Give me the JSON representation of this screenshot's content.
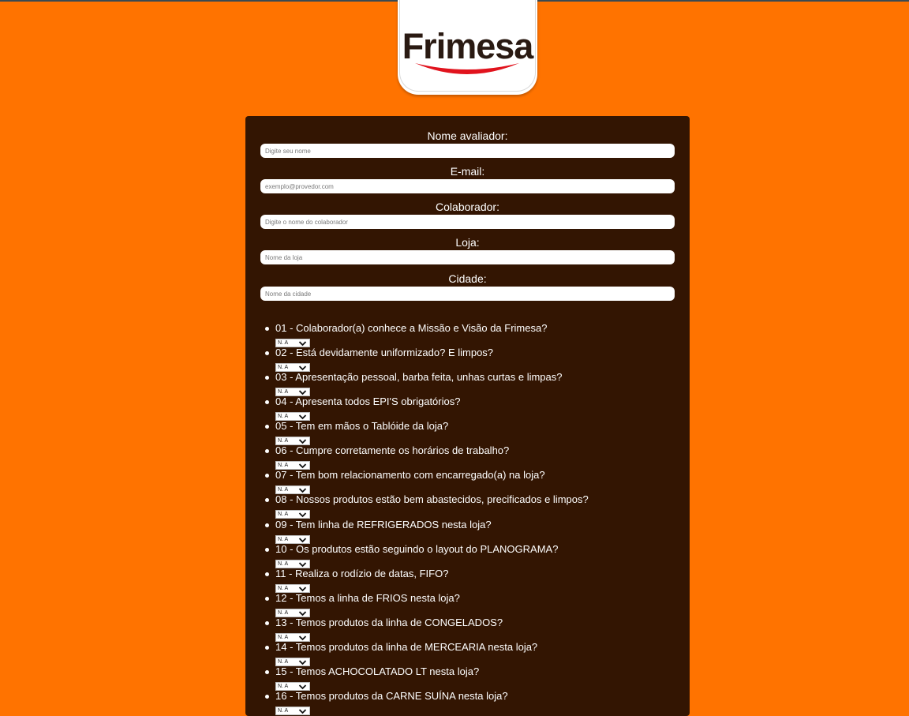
{
  "brand": {
    "logo_text": "Frimesa",
    "accent": "#ff7300",
    "panel": "#331502"
  },
  "form": {
    "fields": [
      {
        "label": "Nome avaliador:",
        "placeholder": "Digite seu nome"
      },
      {
        "label": "E-mail:",
        "placeholder": "exemplo@provedor.com"
      },
      {
        "label": "Colaborador:",
        "placeholder": "Digite o nome do colaborador"
      },
      {
        "label": "Loja:",
        "placeholder": "Nome da loja"
      },
      {
        "label": "Cidade:",
        "placeholder": "Nome da cidade"
      }
    ],
    "questions": [
      {
        "text": "01 - Colaborador(a) conhece a Missão e Visão da Frimesa?",
        "value": "N. A"
      },
      {
        "text": "02 - Está devidamente uniformizado? E limpos?",
        "value": "N. A"
      },
      {
        "text": "03 - Apresentação pessoal, barba feita, unhas curtas e limpas?",
        "value": "N. A"
      },
      {
        "text": "04 - Apresenta todos EPI'S obrigatórios?",
        "value": "N. A"
      },
      {
        "text": "05 - Tem em mãos o Tablóide da loja?",
        "value": "N. A"
      },
      {
        "text": "06 - Cumpre corretamente os horários de trabalho?",
        "value": "N. A"
      },
      {
        "text": "07 - Tem bom relacionamento com encarregado(a) na loja?",
        "value": "N. A"
      },
      {
        "text": "08 - Nossos produtos estão bem abastecidos, precificados e limpos?",
        "value": "N. A"
      },
      {
        "text": "09 - Tem linha de REFRIGERADOS nesta loja?",
        "value": "N. A"
      },
      {
        "text": "10 - Os produtos estão seguindo o layout do PLANOGRAMA?",
        "value": "N. A"
      },
      {
        "text": "11 - Realiza o rodízio de datas, FIFO?",
        "value": "N. A"
      },
      {
        "text": "12 - Temos a linha de FRIOS nesta loja?",
        "value": "N. A"
      },
      {
        "text": "13 - Temos produtos da linha de CONGELADOS?",
        "value": "N. A"
      },
      {
        "text": "14 - Temos produtos da linha de MERCEARIA nesta loja?",
        "value": "N. A"
      },
      {
        "text": "15 - Temos ACHOCOLATADO LT nesta loja?",
        "value": "N. A"
      },
      {
        "text": "16 - Temos produtos da CARNE SUÍNA nesta loja?",
        "value": "N. A"
      }
    ]
  }
}
